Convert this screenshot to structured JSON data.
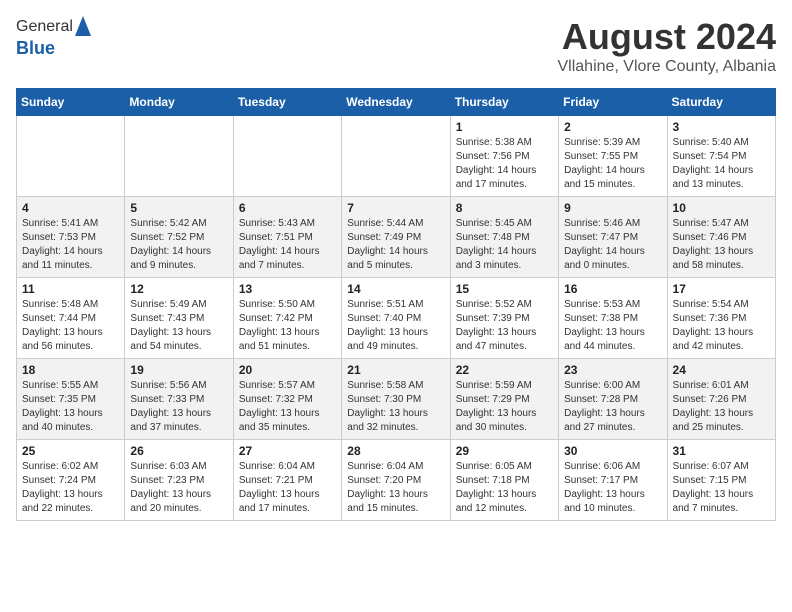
{
  "logo": {
    "line1": "General",
    "line2": "Blue"
  },
  "title": "August 2024",
  "subtitle": "Vllahine, Vlore County, Albania",
  "headers": [
    "Sunday",
    "Monday",
    "Tuesday",
    "Wednesday",
    "Thursday",
    "Friday",
    "Saturday"
  ],
  "weeks": [
    [
      {
        "num": "",
        "info": ""
      },
      {
        "num": "",
        "info": ""
      },
      {
        "num": "",
        "info": ""
      },
      {
        "num": "",
        "info": ""
      },
      {
        "num": "1",
        "info": "Sunrise: 5:38 AM\nSunset: 7:56 PM\nDaylight: 14 hours\nand 17 minutes."
      },
      {
        "num": "2",
        "info": "Sunrise: 5:39 AM\nSunset: 7:55 PM\nDaylight: 14 hours\nand 15 minutes."
      },
      {
        "num": "3",
        "info": "Sunrise: 5:40 AM\nSunset: 7:54 PM\nDaylight: 14 hours\nand 13 minutes."
      }
    ],
    [
      {
        "num": "4",
        "info": "Sunrise: 5:41 AM\nSunset: 7:53 PM\nDaylight: 14 hours\nand 11 minutes."
      },
      {
        "num": "5",
        "info": "Sunrise: 5:42 AM\nSunset: 7:52 PM\nDaylight: 14 hours\nand 9 minutes."
      },
      {
        "num": "6",
        "info": "Sunrise: 5:43 AM\nSunset: 7:51 PM\nDaylight: 14 hours\nand 7 minutes."
      },
      {
        "num": "7",
        "info": "Sunrise: 5:44 AM\nSunset: 7:49 PM\nDaylight: 14 hours\nand 5 minutes."
      },
      {
        "num": "8",
        "info": "Sunrise: 5:45 AM\nSunset: 7:48 PM\nDaylight: 14 hours\nand 3 minutes."
      },
      {
        "num": "9",
        "info": "Sunrise: 5:46 AM\nSunset: 7:47 PM\nDaylight: 14 hours\nand 0 minutes."
      },
      {
        "num": "10",
        "info": "Sunrise: 5:47 AM\nSunset: 7:46 PM\nDaylight: 13 hours\nand 58 minutes."
      }
    ],
    [
      {
        "num": "11",
        "info": "Sunrise: 5:48 AM\nSunset: 7:44 PM\nDaylight: 13 hours\nand 56 minutes."
      },
      {
        "num": "12",
        "info": "Sunrise: 5:49 AM\nSunset: 7:43 PM\nDaylight: 13 hours\nand 54 minutes."
      },
      {
        "num": "13",
        "info": "Sunrise: 5:50 AM\nSunset: 7:42 PM\nDaylight: 13 hours\nand 51 minutes."
      },
      {
        "num": "14",
        "info": "Sunrise: 5:51 AM\nSunset: 7:40 PM\nDaylight: 13 hours\nand 49 minutes."
      },
      {
        "num": "15",
        "info": "Sunrise: 5:52 AM\nSunset: 7:39 PM\nDaylight: 13 hours\nand 47 minutes."
      },
      {
        "num": "16",
        "info": "Sunrise: 5:53 AM\nSunset: 7:38 PM\nDaylight: 13 hours\nand 44 minutes."
      },
      {
        "num": "17",
        "info": "Sunrise: 5:54 AM\nSunset: 7:36 PM\nDaylight: 13 hours\nand 42 minutes."
      }
    ],
    [
      {
        "num": "18",
        "info": "Sunrise: 5:55 AM\nSunset: 7:35 PM\nDaylight: 13 hours\nand 40 minutes."
      },
      {
        "num": "19",
        "info": "Sunrise: 5:56 AM\nSunset: 7:33 PM\nDaylight: 13 hours\nand 37 minutes."
      },
      {
        "num": "20",
        "info": "Sunrise: 5:57 AM\nSunset: 7:32 PM\nDaylight: 13 hours\nand 35 minutes."
      },
      {
        "num": "21",
        "info": "Sunrise: 5:58 AM\nSunset: 7:30 PM\nDaylight: 13 hours\nand 32 minutes."
      },
      {
        "num": "22",
        "info": "Sunrise: 5:59 AM\nSunset: 7:29 PM\nDaylight: 13 hours\nand 30 minutes."
      },
      {
        "num": "23",
        "info": "Sunrise: 6:00 AM\nSunset: 7:28 PM\nDaylight: 13 hours\nand 27 minutes."
      },
      {
        "num": "24",
        "info": "Sunrise: 6:01 AM\nSunset: 7:26 PM\nDaylight: 13 hours\nand 25 minutes."
      }
    ],
    [
      {
        "num": "25",
        "info": "Sunrise: 6:02 AM\nSunset: 7:24 PM\nDaylight: 13 hours\nand 22 minutes."
      },
      {
        "num": "26",
        "info": "Sunrise: 6:03 AM\nSunset: 7:23 PM\nDaylight: 13 hours\nand 20 minutes."
      },
      {
        "num": "27",
        "info": "Sunrise: 6:04 AM\nSunset: 7:21 PM\nDaylight: 13 hours\nand 17 minutes."
      },
      {
        "num": "28",
        "info": "Sunrise: 6:04 AM\nSunset: 7:20 PM\nDaylight: 13 hours\nand 15 minutes."
      },
      {
        "num": "29",
        "info": "Sunrise: 6:05 AM\nSunset: 7:18 PM\nDaylight: 13 hours\nand 12 minutes."
      },
      {
        "num": "30",
        "info": "Sunrise: 6:06 AM\nSunset: 7:17 PM\nDaylight: 13 hours\nand 10 minutes."
      },
      {
        "num": "31",
        "info": "Sunrise: 6:07 AM\nSunset: 7:15 PM\nDaylight: 13 hours\nand 7 minutes."
      }
    ]
  ]
}
